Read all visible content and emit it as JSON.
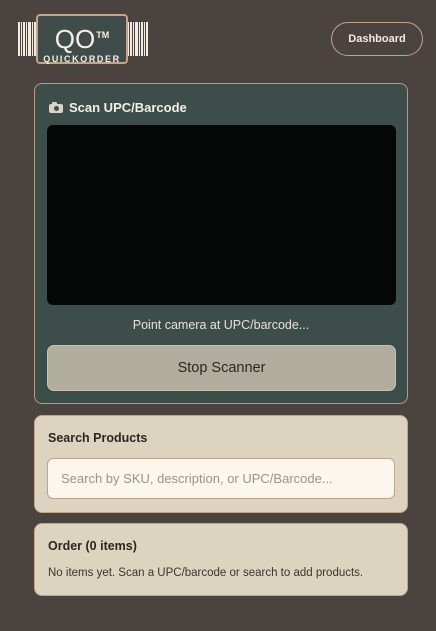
{
  "header": {
    "logo": {
      "mark": "QO",
      "trademark": "TM",
      "text": "QUICKORDER"
    },
    "dashboard_label": "Dashboard"
  },
  "scanner": {
    "title": "Scan UPC/Barcode",
    "icon": "camera-icon",
    "status": "Point camera at UPC/barcode...",
    "stop_label": "Stop Scanner"
  },
  "search": {
    "title": "Search Products",
    "placeholder": "Search by SKU, description, or UPC/Barcode...",
    "value": ""
  },
  "order": {
    "title": "Order (0 items)",
    "empty_text": "No items yet. Scan a UPC/barcode or search to add products."
  },
  "colors": {
    "background": "#4b433f",
    "scanner_card": "#3d4d4a",
    "accent_border": "#c4a58a",
    "light_card": "#ddd4c0",
    "stop_button": "#b1ad9c",
    "camera_view": "#060808"
  }
}
